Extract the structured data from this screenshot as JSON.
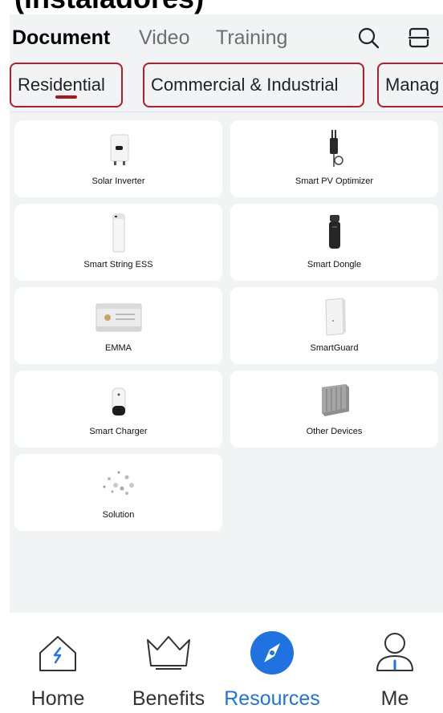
{
  "header": {
    "title": "(instaladores)"
  },
  "top_tabs": [
    {
      "label": "Document",
      "active": true
    },
    {
      "label": "Video",
      "active": false
    },
    {
      "label": "Training",
      "active": false
    }
  ],
  "icons": {
    "search": "search-icon",
    "scan": "scan-icon"
  },
  "categories": [
    {
      "label": "Residential",
      "active": true
    },
    {
      "label": "Commercial & Industrial",
      "active": false
    },
    {
      "label": "Manag",
      "active": false
    }
  ],
  "products": [
    {
      "label": "Solar Inverter",
      "icon": "solar-inverter-icon"
    },
    {
      "label": "Smart PV Optimizer",
      "icon": "pv-optimizer-icon"
    },
    {
      "label": "Smart String ESS",
      "icon": "string-ess-icon"
    },
    {
      "label": "Smart Dongle",
      "icon": "dongle-icon"
    },
    {
      "label": "EMMA",
      "icon": "emma-icon"
    },
    {
      "label": "SmartGuard",
      "icon": "smartguard-icon"
    },
    {
      "label": "Smart Charger",
      "icon": "charger-icon"
    },
    {
      "label": "Other Devices",
      "icon": "other-devices-icon"
    },
    {
      "label": "Solution",
      "icon": "solution-icon"
    }
  ],
  "bottom_nav": [
    {
      "label": "Home",
      "icon": "home-icon",
      "active": false
    },
    {
      "label": "Benefits",
      "icon": "crown-icon",
      "active": false
    },
    {
      "label": "Resources",
      "icon": "compass-icon",
      "active": true
    },
    {
      "label": "Me",
      "icon": "person-icon",
      "active": false
    }
  ],
  "colors": {
    "accent": "#1f72e0",
    "highlight_border": "#b0202c",
    "underline": "#a8151f",
    "content_bg": "#f1f3f5"
  }
}
